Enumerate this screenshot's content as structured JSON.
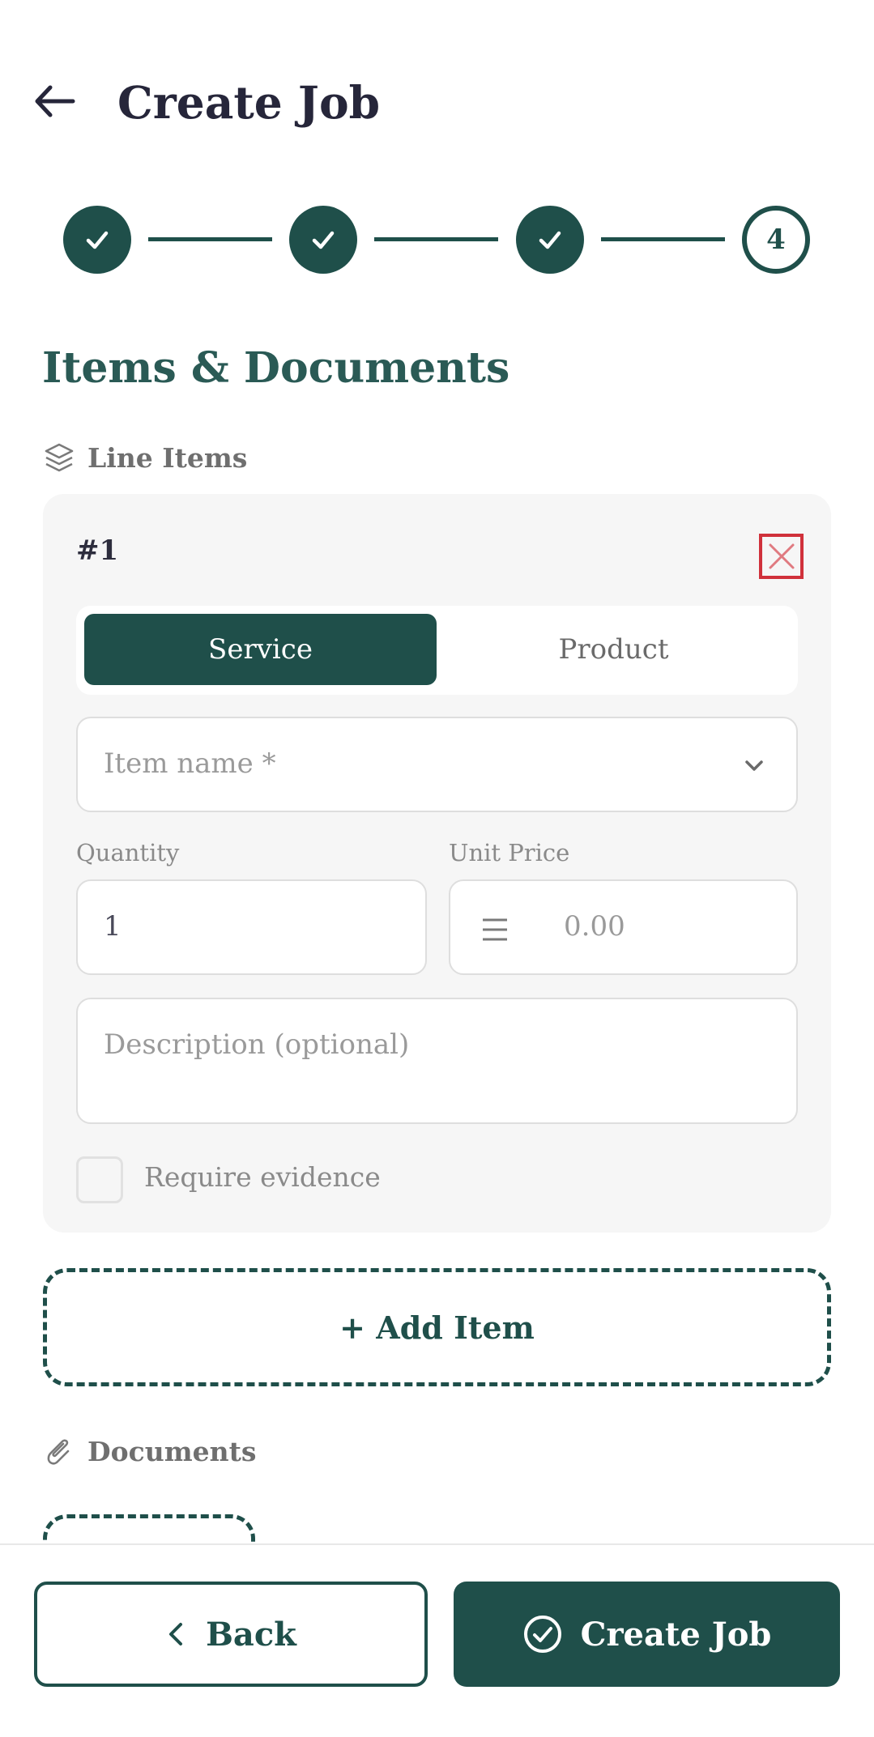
{
  "header": {
    "title": "Create Job",
    "back_icon": "arrow-left-icon"
  },
  "stepper": {
    "steps": [
      {
        "state": "done",
        "icon": "check-icon"
      },
      {
        "state": "done",
        "icon": "check-icon"
      },
      {
        "state": "done",
        "icon": "check-icon"
      },
      {
        "state": "current",
        "label": "4"
      }
    ]
  },
  "section": {
    "title": "Items & Documents",
    "line_items_label": "Line Items",
    "documents_label": "Documents"
  },
  "item": {
    "number": "#1",
    "type_options": [
      "Service",
      "Product"
    ],
    "selected_type": "Service",
    "name_placeholder": "Item name *",
    "quantity_label": "Quantity",
    "quantity_value": "1",
    "unit_price_label": "Unit Price",
    "unit_price_placeholder": "0.00",
    "description_placeholder": "Description (optional)",
    "require_evidence_label": "Require evidence",
    "require_evidence_checked": false
  },
  "actions": {
    "add_item_label": "+ Add Item",
    "back_label": "Back",
    "create_label": "Create Job"
  },
  "colors": {
    "primary": "#1f4f4a",
    "danger": "#d0313b",
    "card_bg": "#f6f6f6"
  }
}
